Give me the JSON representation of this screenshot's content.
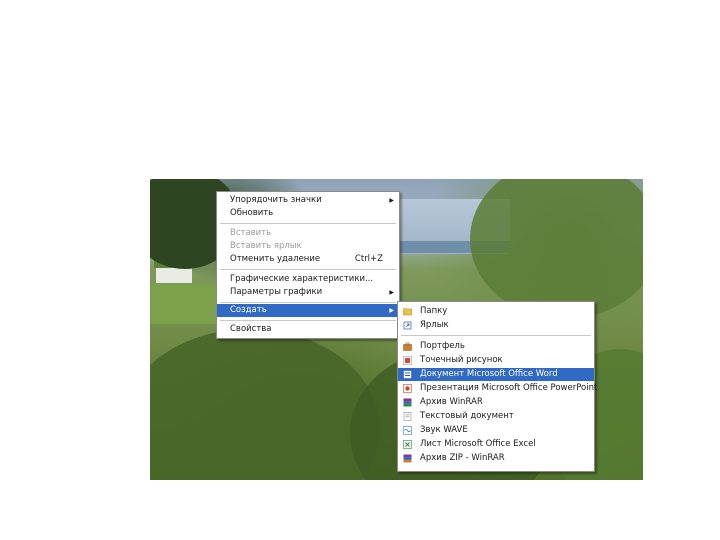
{
  "context_menu": {
    "items": [
      {
        "label": "Упорядочить значки",
        "submenu": true,
        "disabled": false
      },
      {
        "label": "Обновить",
        "disabled": false
      },
      {
        "label": "Вставить",
        "disabled": true
      },
      {
        "label": "Вставить ярлык",
        "disabled": true
      },
      {
        "label": "Отменить удаление",
        "shortcut": "Ctrl+Z",
        "disabled": false
      },
      {
        "label": "Графические характеристики...",
        "disabled": false
      },
      {
        "label": "Параметры графики",
        "submenu": true,
        "disabled": false
      },
      {
        "label": "Создать",
        "submenu": true,
        "selected": true
      },
      {
        "label": "Свойства",
        "disabled": false
      }
    ],
    "arrow_glyph": "▶"
  },
  "submenu": {
    "items": [
      {
        "label": "Папку",
        "icon": "folder-icon",
        "color": "#e8c24a"
      },
      {
        "label": "Ярлык",
        "icon": "shortcut-icon",
        "color": "#3a5fa8"
      },
      {
        "label": "Портфель",
        "icon": "briefcase-icon",
        "color": "#c9822a"
      },
      {
        "label": "Точечный рисунок",
        "icon": "bitmap-icon",
        "color": "#d04a3a"
      },
      {
        "label": "Документ Microsoft Office Word",
        "icon": "word-doc-icon",
        "color": "#2b5fb4",
        "selected": true
      },
      {
        "label": "Презентация Microsoft Office PowerPoint",
        "icon": "powerpoint-icon",
        "color": "#c8452a"
      },
      {
        "label": "Архив WinRAR",
        "icon": "rar-archive-icon",
        "color": "#8a2e8a"
      },
      {
        "label": "Текстовый документ",
        "icon": "text-doc-icon",
        "color": "#8a8a8a"
      },
      {
        "label": "Звук WAVE",
        "icon": "wave-sound-icon",
        "color": "#3a7fc0"
      },
      {
        "label": "Лист Microsoft Office Excel",
        "icon": "excel-sheet-icon",
        "color": "#2f8a3a"
      },
      {
        "label": "Архив ZIP - WinRAR",
        "icon": "zip-archive-icon",
        "color": "#7a3aa0"
      }
    ]
  },
  "colors": {
    "selection": "#316ac5",
    "menu_background": "#ffffff",
    "disabled_text": "#9a9a9a"
  }
}
